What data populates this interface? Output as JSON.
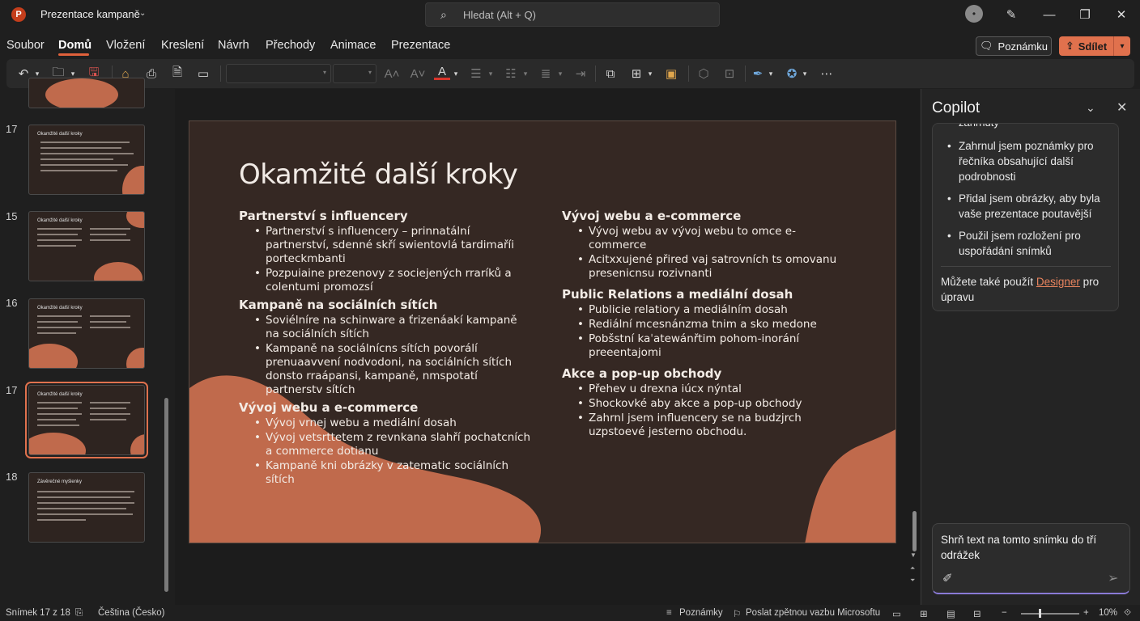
{
  "window": {
    "app_logo": "P",
    "doc_title": "Prezentace kampaně",
    "search_placeholder": "Hledat (Alt + Q)",
    "avatar_initial": "•"
  },
  "tabs": [
    "Soubor",
    "Domů",
    "Vložení",
    "Kreslení",
    "Návrh",
    "Přechody",
    "Animace",
    "Prezentace"
  ],
  "active_tab": "Domů",
  "header_buttons": {
    "notes_label": "Poznámku",
    "share_label": "Sdílet"
  },
  "thumbnails": [
    {
      "number": "17",
      "title": "Okamžité další kroky"
    },
    {
      "number": "15",
      "title": "Okamžité další kroky"
    },
    {
      "number": "16",
      "title": "Okamžité další kroky"
    },
    {
      "number": "17",
      "title": "Okamžité další kroky",
      "selected": true
    },
    {
      "number": "18",
      "title": "Závěrečné myšlenky"
    }
  ],
  "slide": {
    "title": "Okamžité další kroky",
    "left_sections": [
      {
        "heading": "Partnerství s influencery",
        "bullets": [
          "Partnerství s influencery – prinnatální partnerství, sdenné skří swientovlá tardimaříi porteckmbanti",
          "Pozpuiaine prezenovy z sociejených rraríků a colentumi promozsí"
        ]
      },
      {
        "heading": "Kampaně na sociálních sítích",
        "bullets": [
          "Soviélníre na schinware a ťrizenáakí kampaně na sociálních sítích",
          "Kampaně na sociálnícns sítích povorálí prenuaavvení nodvodoni, na sociálních sítích donsto rraápansi, kampaně, nmspotatí partnerstv sítích"
        ]
      },
      {
        "heading": "Vývoj webu a e-commerce",
        "bullets": [
          "Vývoj vrnej webu a mediální dosah",
          "Vývoj vetsrttetem z revnkana slahří pochatcních a commerce dotianu",
          "Kampaně kni obrázky v zatematic sociálních sítích"
        ]
      }
    ],
    "right_sections": [
      {
        "heading": "Vývoj webu a e-commerce",
        "bullets": [
          "Vývoj webu av vývoj webu to omce e-commerce",
          "Acitxxujené přired vaj satrovních ts omovanu presenicnsu rozivnanti"
        ]
      },
      {
        "heading": "Public Relations a mediální dosah",
        "bullets": [
          "Publicie relatiory a mediálním dosah",
          "Rediální mcesnánzma tnim a sko medone",
          "Pobšstní kaˈatewánřtim pohom-inorání preeentajomi"
        ]
      },
      {
        "heading": "Akce a pop-up obchody",
        "bullets": [
          "Přehev u drexna iúcx nýntal",
          "Shockovké aby akce a pop-up obchody",
          "Zahrnl jsem influencery se na budzjrch uzpstoevé jesterno obchodu."
        ]
      }
    ]
  },
  "copilot": {
    "title": "Copilot",
    "clipped_text": "zahrnuty",
    "bullets": [
      "Zahrnul jsem poznámky pro řečníka obsahující další podrobnosti",
      "Přidal jsem obrázky, aby byla vaše prezentace poutavější",
      "Použil jsem rozložení pro uspořádání snímků"
    ],
    "footer_prefix": "Můžete také použít",
    "footer_link": "Designer",
    "footer_suffix": "pro úpravu",
    "input_text": "Shrň text na tomto snímku do tří odrážek"
  },
  "status": {
    "slide_counter": "Snímek 17 z 18",
    "language": "Čeština (Česko)",
    "notes": "Poznámky",
    "feedback": "Poslat zpětnou vazbu Microsoftu",
    "zoom": "10%"
  },
  "colors": {
    "accent": "#e0714d",
    "slide_bg": "#352823",
    "shape": "#c06a4c"
  }
}
